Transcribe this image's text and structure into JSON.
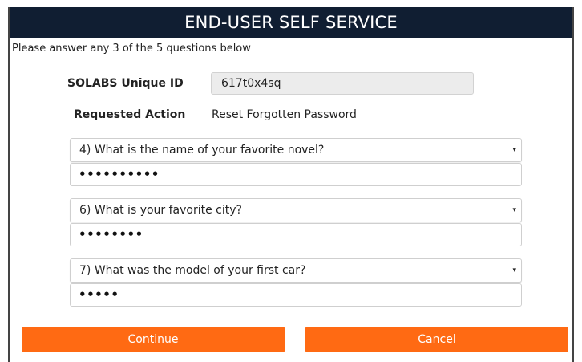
{
  "header": {
    "title": "END-USER SELF SERVICE"
  },
  "instructions": "Please answer any 3 of the 5 questions below",
  "unique_id": {
    "label": "SOLABS Unique ID",
    "value": "617t0x4sq"
  },
  "requested_action": {
    "label": "Requested Action",
    "value": "Reset Forgotten Password"
  },
  "questions": [
    {
      "selected": "4) What is the name of your favorite novel?",
      "answer_mask": "••••••••••"
    },
    {
      "selected": "6) What is your favorite city?",
      "answer_mask": "••••••••"
    },
    {
      "selected": "7) What was the model of your first car?",
      "answer_mask": "•••••"
    }
  ],
  "buttons": {
    "continue_label": "Continue",
    "cancel_label": "Cancel"
  },
  "colors": {
    "header_bg": "#101e32",
    "button_bg": "#ff6a13"
  },
  "icons": {
    "caret": "▾"
  }
}
